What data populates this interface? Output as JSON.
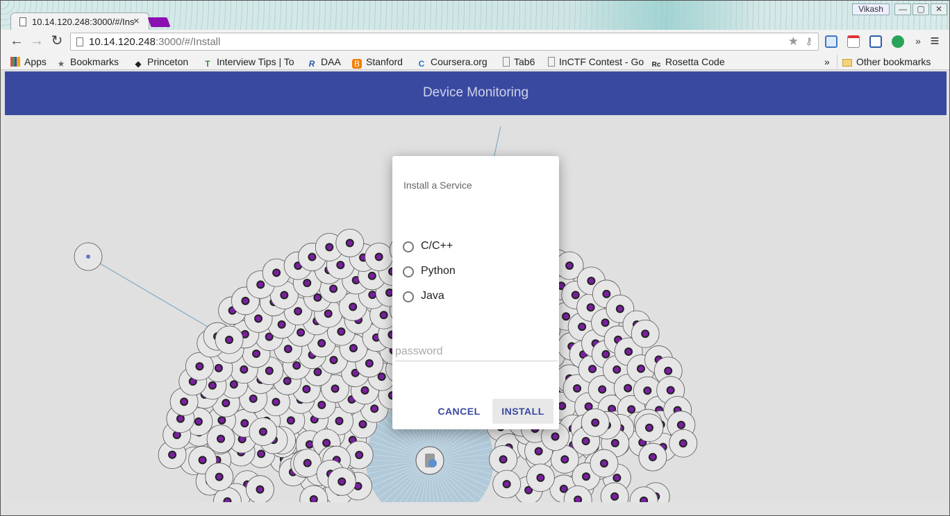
{
  "window": {
    "profile_name": "Vikash",
    "minimize_label": "—",
    "maximize_label": "▢",
    "close_label": "✕"
  },
  "tab": {
    "title": "10.14.120.248:3000/#/Install",
    "close_label": "×"
  },
  "address_bar": {
    "host": "10.14.120.248",
    "rest": ":3000/#/Install"
  },
  "toolbar": {
    "back_icon": "←",
    "forward_icon": "→",
    "reload_icon": "↻",
    "overflow": "»",
    "menu_icon": "≡"
  },
  "bookmarks": {
    "items": [
      {
        "label": "Apps",
        "icon": "apps-grid-icon"
      },
      {
        "label": "Bookmarks",
        "icon": "star-icon"
      },
      {
        "label": "Princeton",
        "icon": "princeton-icon"
      },
      {
        "label": "Interview Tips | To",
        "icon": "tt-icon"
      },
      {
        "label": "DAA",
        "icon": "r-icon"
      },
      {
        "label": "Stanford",
        "icon": "blogger-icon"
      },
      {
        "label": "Coursera.org",
        "icon": "coursera-icon"
      },
      {
        "label": "Tab6",
        "icon": "page-icon"
      },
      {
        "label": "InCTF Contest - Go",
        "icon": "page-icon"
      },
      {
        "label": "Rosetta Code",
        "icon": "rosetta-icon"
      }
    ],
    "overflow": "»",
    "other": "Other bookmarks"
  },
  "app": {
    "title": "Device Monitoring"
  },
  "dialog": {
    "title": "Install a Service",
    "options": [
      "C/C++",
      "Python",
      "Java"
    ],
    "password_placeholder": "password",
    "cancel_label": "CANCEL",
    "install_label": "INSTALL"
  },
  "colors": {
    "appbar": "#3949a0",
    "node_fill": "#e6e6e6",
    "node_core": "#7a1fa0",
    "link": "#8aaec4",
    "hub_bg": "#a8c4d6"
  }
}
